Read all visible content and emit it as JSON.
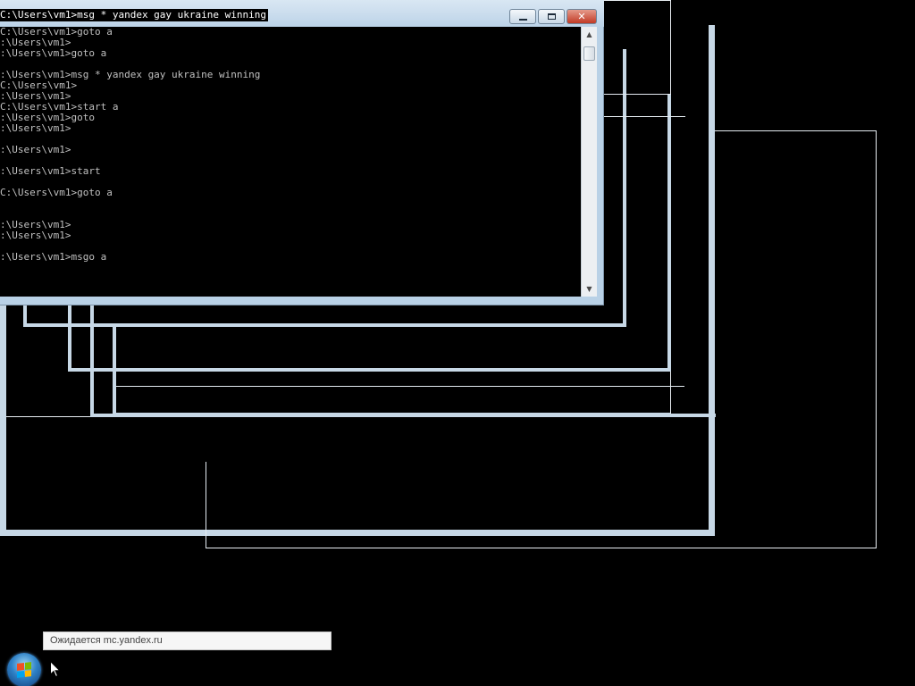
{
  "window": {
    "title": "C:\\Users\\vm1>msg * yandex gay ukraine winning",
    "controls": {
      "minimize": "minimize-icon",
      "maximize": "maximize-icon",
      "close": "✕"
    }
  },
  "console": {
    "lines": [
      "C:\\Users\\vm1>goto a",
      ":\\Users\\vm1>",
      ":\\Users\\vm1>goto a",
      "",
      ":\\Users\\vm1>msg * yandex gay ukraine winning",
      "C:\\Users\\vm1>",
      ":\\Users\\vm1>",
      "C:\\Users\\vm1>start a",
      ":\\Users\\vm1>goto",
      ":\\Users\\vm1>",
      "",
      ":\\Users\\vm1>",
      "",
      ":\\Users\\vm1>start",
      "",
      "C:\\Users\\vm1>goto a",
      "",
      "",
      ":\\Users\\vm1>",
      ":\\Users\\vm1>",
      "",
      ":\\Users\\vm1>msgo a"
    ]
  },
  "tooltip": {
    "text": "Ожидается mc.yandex.ru"
  },
  "taskbar": {
    "start_icon": "windows-logo-icon"
  },
  "colors": {
    "background": "#000000",
    "console_text": "#c0c0c0",
    "frame": "#c7d8e6"
  }
}
